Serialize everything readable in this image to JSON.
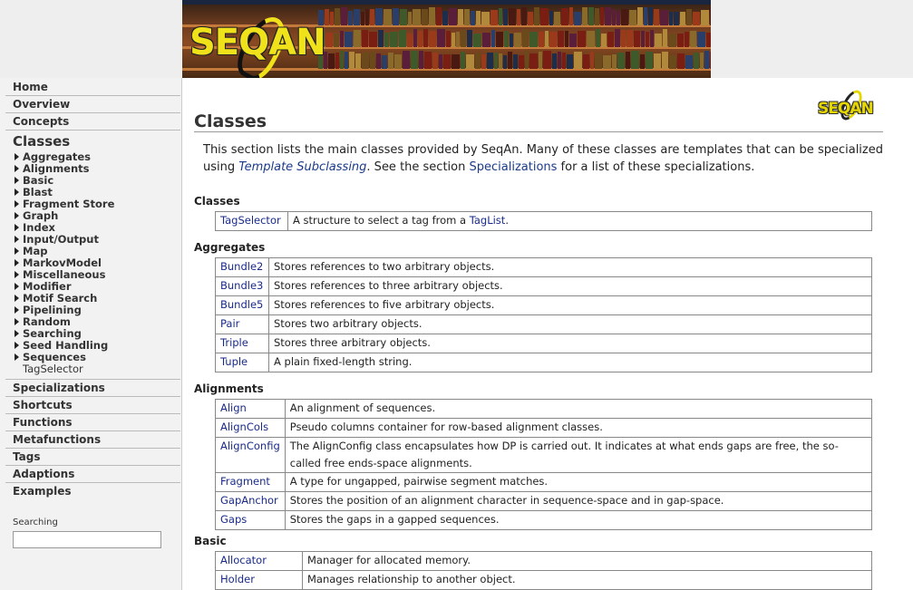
{
  "banner": {
    "logo_text": "SEQAN"
  },
  "sidebar": {
    "top_items": [
      {
        "label": "Home"
      },
      {
        "label": "Overview"
      },
      {
        "label": "Concepts"
      }
    ],
    "current_section": "Classes",
    "class_groups": [
      "Aggregates",
      "Alignments",
      "Basic",
      "Blast",
      "Fragment Store",
      "Graph",
      "Index",
      "Input/Output",
      "Map",
      "MarkovModel",
      "Miscellaneous",
      "Modifier",
      "Motif Search",
      "Pipelining",
      "Random",
      "Searching",
      "Seed Handling",
      "Sequences"
    ],
    "class_plain_item": "TagSelector",
    "bottom_items": [
      {
        "label": "Specializations"
      },
      {
        "label": "Shortcuts"
      },
      {
        "label": "Functions"
      },
      {
        "label": "Metafunctions"
      },
      {
        "label": "Tags"
      },
      {
        "label": "Adaptions"
      },
      {
        "label": "Examples"
      }
    ],
    "search": {
      "label": "Searching",
      "value": ""
    }
  },
  "main": {
    "title": "Classes",
    "logo_text": "SEQAN",
    "intro": {
      "part1": "This section lists the main classes provided by SeqAn. Many of these classes are templates that can be specialized using ",
      "link1": "Template Subclassing",
      "part2": ". See the section ",
      "link2": "Specializations",
      "part3": " for a list of these specializations."
    },
    "sections": {
      "classes": {
        "heading": "Classes",
        "rows": [
          {
            "name": "TagSelector",
            "desc_pre": "A structure to select a tag from a ",
            "desc_link": "TagList",
            "desc_post": "."
          }
        ]
      },
      "aggregates": {
        "heading": "Aggregates",
        "rows": [
          {
            "name": "Bundle2",
            "desc": "Stores references to two arbitrary objects."
          },
          {
            "name": "Bundle3",
            "desc": "Stores references to three arbitrary objects."
          },
          {
            "name": "Bundle5",
            "desc": "Stores references to five arbitrary objects."
          },
          {
            "name": "Pair",
            "desc": "Stores two arbitrary objects."
          },
          {
            "name": "Triple",
            "desc": "Stores three arbitrary objects."
          },
          {
            "name": "Tuple",
            "desc": "A plain fixed-length string."
          }
        ]
      },
      "alignments": {
        "heading": "Alignments",
        "rows": [
          {
            "name": "Align",
            "desc": "An alignment of sequences."
          },
          {
            "name": "AlignCols",
            "desc": "Pseudo columns container for row-based alignment classes."
          },
          {
            "name": "AlignConfig",
            "desc": "The AlignConfig class encapsulates how DP is carried out. It indicates at what ends gaps are free, the so-called free ends-space alignments."
          },
          {
            "name": "Fragment",
            "desc": "A type for ungapped, pairwise segment matches."
          },
          {
            "name": "GapAnchor",
            "desc": "Stores the position of an alignment character in sequence-space and in gap-space."
          },
          {
            "name": "Gaps",
            "desc": "Stores the gaps in a gapped sequences."
          }
        ]
      },
      "basic": {
        "heading": "Basic",
        "rows": [
          {
            "name": "Allocator",
            "desc": "Manager for allocated memory."
          },
          {
            "name": "Holder",
            "desc": "Manages relationship to another object."
          }
        ]
      }
    }
  }
}
